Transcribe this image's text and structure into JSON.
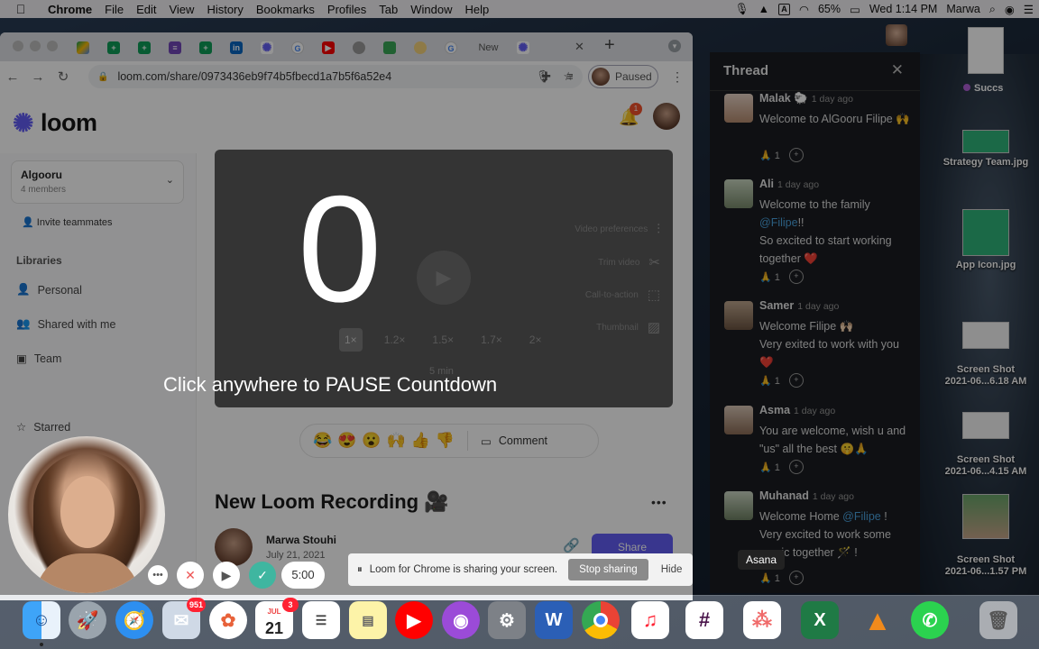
{
  "menubar": {
    "app": "Chrome",
    "items": [
      "File",
      "Edit",
      "View",
      "History",
      "Bookmarks",
      "Profiles",
      "Tab",
      "Window",
      "Help"
    ],
    "battery": "65%",
    "clock": "Wed 1:14 PM",
    "user": "Marwa",
    "input_source": "A"
  },
  "browser": {
    "url": "loom.com/share/0973436eb9f74b5fbecd1a7b5f6a52e4",
    "profile_status": "Paused",
    "tab_partial_label": "New"
  },
  "loom": {
    "logo_text": "loom",
    "notification_count": "1",
    "workspace": {
      "name": "Algooru",
      "members": "4 members"
    },
    "invite_label": "Invite teammates",
    "libraries_heading": "Libraries",
    "nav": [
      {
        "label": "Personal",
        "icon": "person-icon"
      },
      {
        "label": "Shared with me",
        "icon": "people-icon"
      },
      {
        "label": "Team",
        "icon": "team-icon"
      }
    ],
    "starred_label": "Starred",
    "player": {
      "options": [
        "Video preferences",
        "Trim video",
        "Call-to-action",
        "Thumbnail"
      ],
      "speeds": [
        "1×",
        "1.2×",
        "1.5×",
        "1.7×",
        "2×"
      ],
      "selected_speed": "1×",
      "duration": "5 min"
    },
    "reactions": [
      "😂",
      "😍",
      "😮",
      "🙌",
      "👍",
      "👎"
    ],
    "comment_label": "Comment",
    "video_title": "New Loom Recording 🎥",
    "author_name": "Marwa Stouhi",
    "author_date": "July 21, 2021",
    "share_label": "Share"
  },
  "countdown": {
    "value": "0",
    "message": "Click anywhere to PAUSE Countdown"
  },
  "recorder": {
    "timer": "5:00"
  },
  "screen_share": {
    "message": "Loom for Chrome is sharing your screen.",
    "stop_label": "Stop sharing",
    "hide_label": "Hide"
  },
  "thread": {
    "title": "Thread",
    "messages": [
      {
        "name": "Malak 🐑",
        "time": "1 day ago",
        "lines": [
          "Welcome to AlGooru Filipe 🙌"
        ],
        "reaction": "🙏",
        "count": "1"
      },
      {
        "name": "Ali",
        "time": "1 day ago",
        "pre": "Welcome to the family",
        "mention": "@Filipe",
        "post": "!!",
        "extra": "So excited to start working together ❤️",
        "reaction": "🙏",
        "count": "1"
      },
      {
        "name": "Samer",
        "time": "1 day ago",
        "lines": [
          "Welcome Filipe 🙌🏻",
          "Very exited to work with you ❤️"
        ],
        "reaction": "🙏",
        "count": "1"
      },
      {
        "name": "Asma",
        "time": "1 day ago",
        "lines": [
          "You are welcome, wish u and \"us\" all the best 🤫🙏"
        ],
        "reaction": "🙏",
        "count": "1"
      },
      {
        "name": "Muhanad",
        "time": "1 day ago",
        "pre": "Welcome Home",
        "mention": "@Filipe",
        "post": "!",
        "extra": "Very excited to work some magic together 🪄 !",
        "reaction": "🙏",
        "count": "1"
      }
    ]
  },
  "tooltip": "Asana",
  "desktop": {
    "succs_label": "Succs",
    "files": [
      {
        "label": "Strategy Team.jpg"
      },
      {
        "label": "App Icon.jpg"
      },
      {
        "label": "Screen Shot\n2021-06...6.18 AM"
      },
      {
        "label": "Screen Shot\n2021-06...4.15 AM"
      },
      {
        "label": "Screen Shot\n2021-06...1.57 PM"
      }
    ]
  },
  "dock": {
    "mail_badge": "951",
    "calendar_month": "JUL",
    "calendar_day": "21",
    "calendar_badge": "3",
    "apps": [
      "Finder",
      "Launchpad",
      "Safari",
      "Mail",
      "Photos",
      "Calendar",
      "Reminders",
      "Notes",
      "YouTube Music",
      "Podcasts",
      "System Preferences",
      "Word",
      "Chrome",
      "Music",
      "Slack",
      "Asana",
      "Excel",
      "VLC",
      "WhatsApp",
      "Trash"
    ]
  }
}
